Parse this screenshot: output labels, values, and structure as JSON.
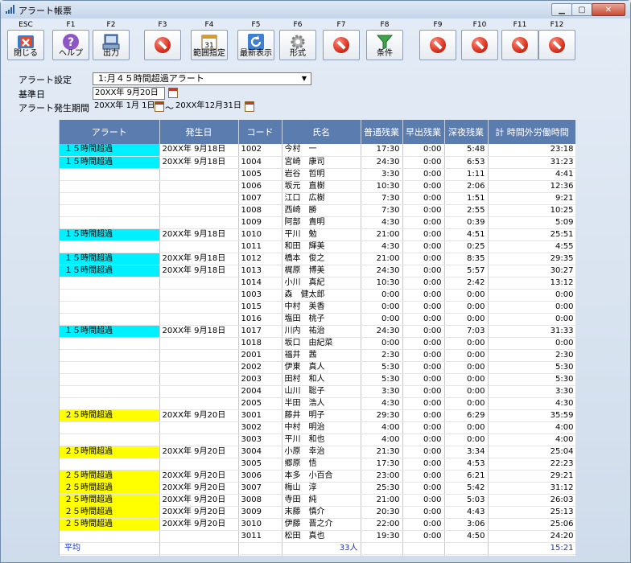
{
  "window": {
    "title": "アラート帳票"
  },
  "toolbar": [
    {
      "fkey": "ESC",
      "label": "閉じる",
      "icon": "close-x-icon",
      "disabled": false
    },
    {
      "fkey": "F1",
      "label": "ヘルプ",
      "icon": "help-icon",
      "disabled": false
    },
    {
      "fkey": "F2",
      "label": "出力",
      "icon": "output-icon",
      "disabled": false
    },
    {
      "fkey": "F3",
      "label": "",
      "icon": "no-entry-icon",
      "disabled": true
    },
    {
      "fkey": "F4",
      "label": "範囲指定",
      "icon": "calendar-range-icon",
      "disabled": false
    },
    {
      "fkey": "F5",
      "label": "最新表示",
      "icon": "refresh-icon",
      "disabled": false
    },
    {
      "fkey": "F6",
      "label": "形式",
      "icon": "gear-icon",
      "disabled": false
    },
    {
      "fkey": "F7",
      "label": "",
      "icon": "no-entry-icon",
      "disabled": true
    },
    {
      "fkey": "F8",
      "label": "条件",
      "icon": "filter-icon",
      "disabled": false
    },
    {
      "fkey": "F9",
      "label": "",
      "icon": "no-entry-icon",
      "disabled": true
    },
    {
      "fkey": "F10",
      "label": "",
      "icon": "no-entry-icon",
      "disabled": true
    },
    {
      "fkey": "F11",
      "label": "",
      "icon": "no-entry-icon",
      "disabled": true
    },
    {
      "fkey": "F12",
      "label": "",
      "icon": "no-entry-icon",
      "disabled": true
    }
  ],
  "form": {
    "alert_setting_label": "アラート設定",
    "alert_setting_value": "1:月４５時間超過アラート",
    "base_date_label": "基準日",
    "base_date_value": "20XX年 9月20日",
    "period_label": "アラート発生期間",
    "period_from": "20XX年 1月 1日",
    "period_sep": "～",
    "period_to": "20XX年12月31日"
  },
  "table": {
    "columns": [
      "アラート",
      "発生日",
      "コード",
      "氏名",
      "普通残業",
      "早出残業",
      "深夜残業",
      "計 時間外労働時間"
    ],
    "rows": [
      [
        "１５時間超過",
        "20XX年 9月18日",
        "1002",
        "今村　一",
        "17:30",
        "0:00",
        "5:48",
        "23:18",
        "a15"
      ],
      [
        "１５時間超過",
        "20XX年 9月18日",
        "1004",
        "宮崎　康司",
        "24:30",
        "0:00",
        "6:53",
        "31:23",
        "a15"
      ],
      [
        "",
        "",
        "1005",
        "岩谷　哲明",
        "3:30",
        "0:00",
        "1:11",
        "4:41",
        ""
      ],
      [
        "",
        "",
        "1006",
        "坂元　直樹",
        "10:30",
        "0:00",
        "2:06",
        "12:36",
        ""
      ],
      [
        "",
        "",
        "1007",
        "江口　広樹",
        "7:30",
        "0:00",
        "1:51",
        "9:21",
        ""
      ],
      [
        "",
        "",
        "1008",
        "西崎　勝",
        "7:30",
        "0:00",
        "2:55",
        "10:25",
        ""
      ],
      [
        "",
        "",
        "1009",
        "阿部　貴明",
        "4:30",
        "0:00",
        "0:39",
        "5:09",
        ""
      ],
      [
        "１５時間超過",
        "20XX年 9月18日",
        "1010",
        "平川　勉",
        "21:00",
        "0:00",
        "4:51",
        "25:51",
        "a15"
      ],
      [
        "",
        "",
        "1011",
        "和田　輝美",
        "4:30",
        "0:00",
        "0:25",
        "4:55",
        ""
      ],
      [
        "１５時間超過",
        "20XX年 9月18日",
        "1012",
        "橋本　俊之",
        "21:00",
        "0:00",
        "8:35",
        "29:35",
        "a15"
      ],
      [
        "１５時間超過",
        "20XX年 9月18日",
        "1013",
        "梶原　博美",
        "24:30",
        "0:00",
        "5:57",
        "30:27",
        "a15"
      ],
      [
        "",
        "",
        "1014",
        "小川　真紀",
        "10:30",
        "0:00",
        "2:42",
        "13:12",
        ""
      ],
      [
        "",
        "",
        "1003",
        "森　健太郎",
        "0:00",
        "0:00",
        "0:00",
        "0:00",
        ""
      ],
      [
        "",
        "",
        "1015",
        "中村　美香",
        "0:00",
        "0:00",
        "0:00",
        "0:00",
        ""
      ],
      [
        "",
        "",
        "1016",
        "塩田　桃子",
        "0:00",
        "0:00",
        "0:00",
        "0:00",
        ""
      ],
      [
        "１５時間超過",
        "20XX年 9月18日",
        "1017",
        "川内　祐治",
        "24:30",
        "0:00",
        "7:03",
        "31:33",
        "a15"
      ],
      [
        "",
        "",
        "1018",
        "坂口　由紀菜",
        "0:00",
        "0:00",
        "0:00",
        "0:00",
        ""
      ],
      [
        "",
        "",
        "2001",
        "福井　茜",
        "2:30",
        "0:00",
        "0:00",
        "2:30",
        ""
      ],
      [
        "",
        "",
        "2002",
        "伊東　真人",
        "5:30",
        "0:00",
        "0:00",
        "5:30",
        ""
      ],
      [
        "",
        "",
        "2003",
        "田村　和人",
        "5:30",
        "0:00",
        "0:00",
        "5:30",
        ""
      ],
      [
        "",
        "",
        "2004",
        "山川　聡子",
        "3:30",
        "0:00",
        "0:00",
        "3:30",
        ""
      ],
      [
        "",
        "",
        "2005",
        "半田　浩人",
        "4:30",
        "0:00",
        "0:00",
        "4:30",
        ""
      ],
      [
        "２５時間超過",
        "20XX年 9月20日",
        "3001",
        "藤井　明子",
        "29:30",
        "0:00",
        "6:29",
        "35:59",
        "a25"
      ],
      [
        "",
        "",
        "3002",
        "中村　明治",
        "4:00",
        "0:00",
        "0:00",
        "4:00",
        ""
      ],
      [
        "",
        "",
        "3003",
        "平川　和也",
        "4:00",
        "0:00",
        "0:00",
        "4:00",
        ""
      ],
      [
        "２５時間超過",
        "20XX年 9月20日",
        "3004",
        "小原　幸治",
        "21:30",
        "0:00",
        "3:34",
        "25:04",
        "a25"
      ],
      [
        "",
        "",
        "3005",
        "郷原　悟",
        "17:30",
        "0:00",
        "4:53",
        "22:23",
        ""
      ],
      [
        "２５時間超過",
        "20XX年 9月20日",
        "3006",
        "本多　小百合",
        "23:00",
        "0:00",
        "6:21",
        "29:21",
        "a25"
      ],
      [
        "２５時間超過",
        "20XX年 9月20日",
        "3007",
        "梅山　淳",
        "25:30",
        "0:00",
        "5:42",
        "31:12",
        "a25"
      ],
      [
        "２５時間超過",
        "20XX年 9月20日",
        "3008",
        "寺田　純",
        "21:00",
        "0:00",
        "5:03",
        "26:03",
        "a25"
      ],
      [
        "２５時間超過",
        "20XX年 9月20日",
        "3009",
        "末藤　慎介",
        "20:30",
        "0:00",
        "4:43",
        "25:13",
        "a25"
      ],
      [
        "２５時間超過",
        "20XX年 9月20日",
        "3010",
        "伊藤　晋之介",
        "22:00",
        "0:00",
        "3:06",
        "25:06",
        "a25"
      ],
      [
        "",
        "",
        "3011",
        "松田　真也",
        "19:30",
        "0:00",
        "4:50",
        "24:20",
        ""
      ]
    ],
    "average": {
      "label": "平均",
      "count": "33人",
      "total": "15:21"
    }
  }
}
